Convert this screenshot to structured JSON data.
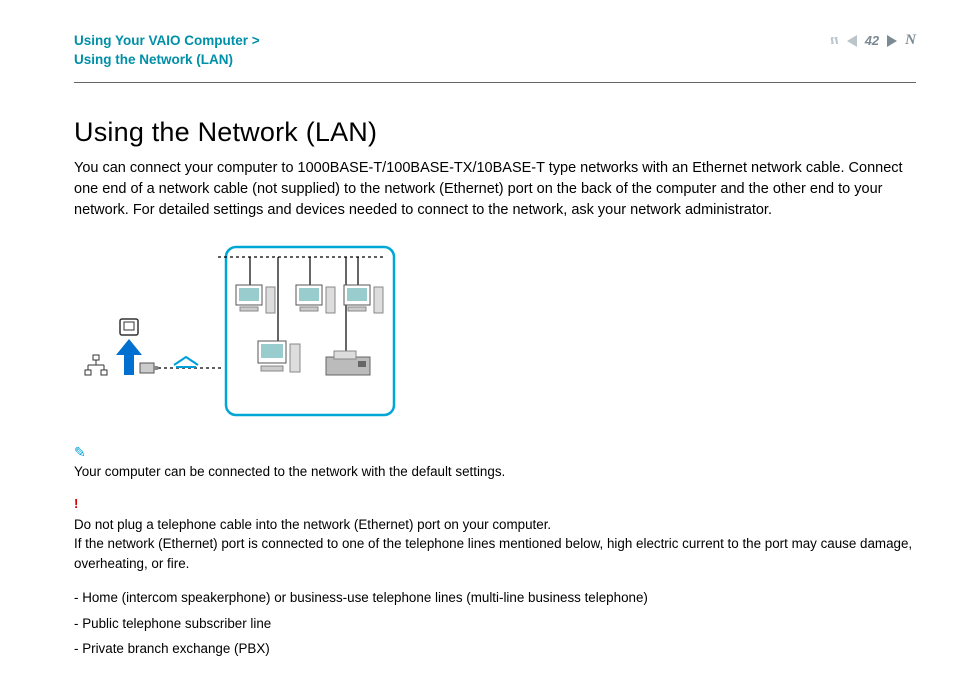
{
  "header": {
    "breadcrumb_line1": "Using Your VAIO Computer >",
    "breadcrumb_line2": "Using the Network (LAN)",
    "page_number": "42",
    "n_mark": "n",
    "N_mark": "N"
  },
  "title": "Using the Network (LAN)",
  "intro": "You can connect your computer to 1000BASE-T/100BASE-TX/10BASE-T type networks with an Ethernet network cable. Connect one end of a network cable (not supplied) to the network (Ethernet) port on the back of the computer and the other end to your network. For detailed settings and devices needed to connect to the network, ask your network administrator.",
  "note": {
    "icon": "✎",
    "text": "Your computer can be connected to the network with the default settings."
  },
  "warning": {
    "icon": "!",
    "line1": "Do not plug a telephone cable into the network (Ethernet) port on your computer.",
    "line2": "If the network (Ethernet) port is connected to one of the telephone lines mentioned below, high electric current to the port may cause damage, overheating, or fire."
  },
  "bullets": [
    "Home (intercom speakerphone) or business-use telephone lines (multi-line business telephone)",
    "Public telephone subscriber line",
    "Private branch exchange (PBX)"
  ]
}
